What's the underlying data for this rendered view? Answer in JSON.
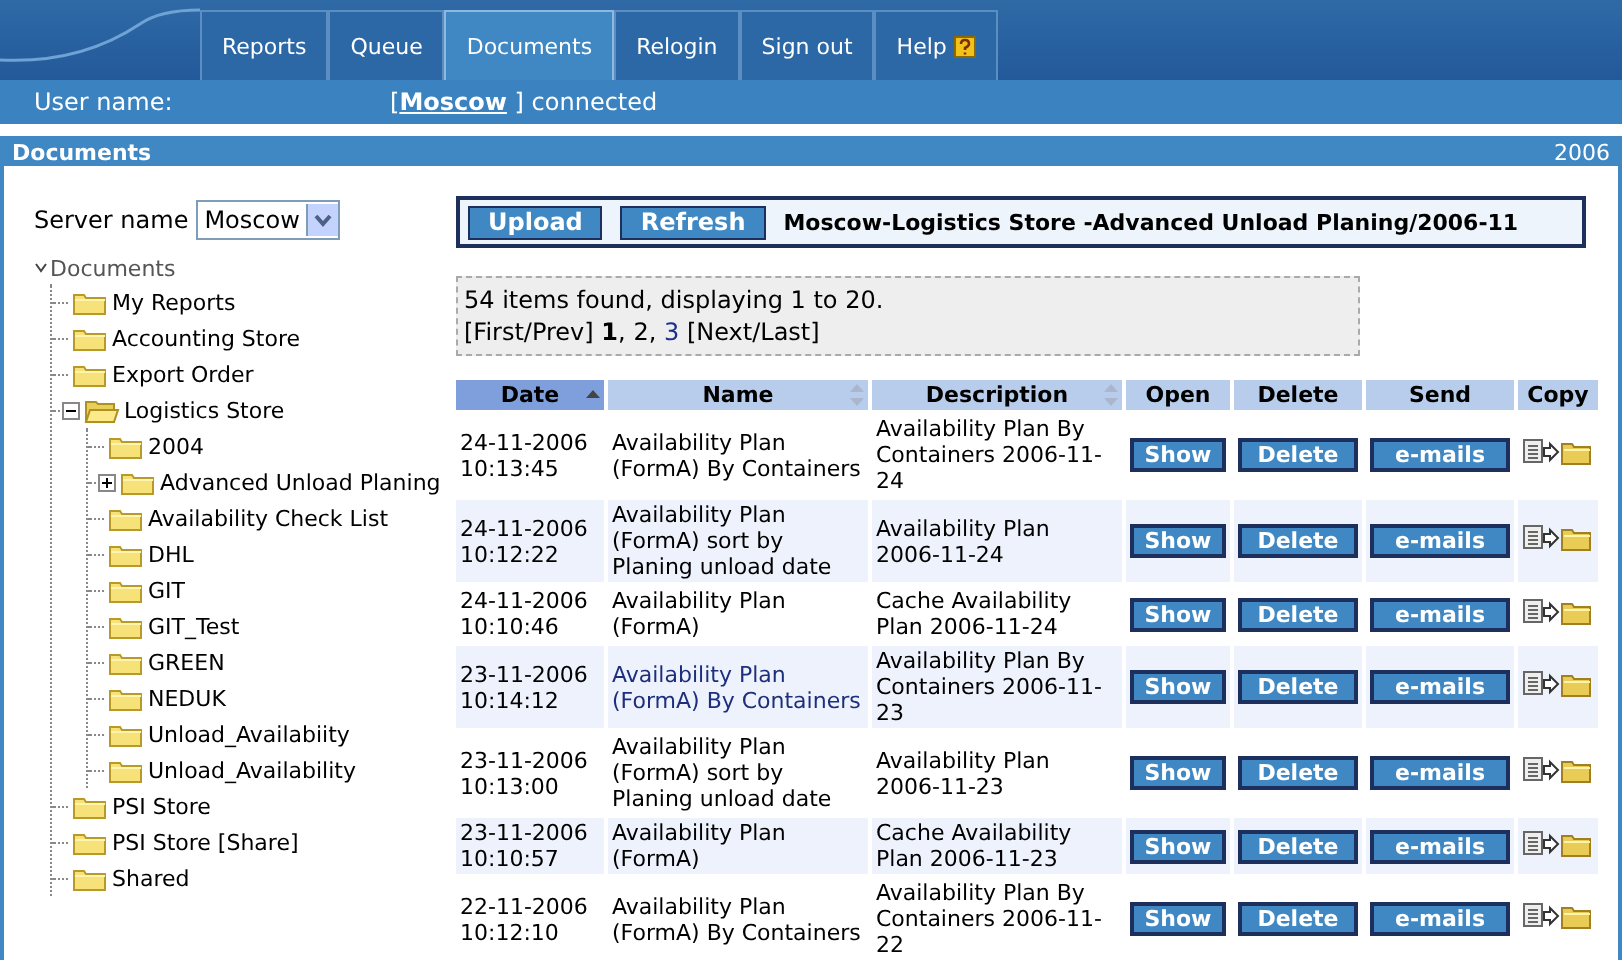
{
  "tabs": [
    {
      "label": "Reports",
      "selected": false,
      "help": false
    },
    {
      "label": "Queue",
      "selected": false,
      "help": false
    },
    {
      "label": "Documents",
      "selected": true,
      "help": false
    },
    {
      "label": "Relogin",
      "selected": false,
      "help": false
    },
    {
      "label": "Sign out",
      "selected": false,
      "help": false
    },
    {
      "label": "Help",
      "selected": false,
      "help": true
    }
  ],
  "user_bar": {
    "label": "User name:",
    "before": "[",
    "link": "Moscow",
    "after": "] connected"
  },
  "panel": {
    "title": "Documents",
    "year": "2006"
  },
  "sidebar": {
    "server_label": "Server name",
    "server_value": "Moscow",
    "tree": {
      "label": "Documents",
      "expanded": true,
      "children": [
        {
          "label": "My Reports"
        },
        {
          "label": "Accounting Store"
        },
        {
          "label": "Export Order"
        },
        {
          "label": "Logistics Store",
          "expanded": true,
          "children": [
            {
              "label": "2004"
            },
            {
              "label": "Advanced Unload Planing",
              "expanded": false
            },
            {
              "label": "Availability Check List"
            },
            {
              "label": "DHL"
            },
            {
              "label": "GIT"
            },
            {
              "label": "GIT_Test"
            },
            {
              "label": "GREEN"
            },
            {
              "label": "NEDUK"
            },
            {
              "label": "Unload_Availabiity"
            },
            {
              "label": "Unload_Availability"
            }
          ]
        },
        {
          "label": "PSI Store"
        },
        {
          "label": "PSI Store [Share]"
        },
        {
          "label": "Shared"
        }
      ]
    }
  },
  "toolbar": {
    "buttons": [
      "Upload",
      "Refresh"
    ],
    "path": "Moscow-Logistics Store -Advanced Unload Planing/2006-11"
  },
  "info": {
    "summary": "54 items found, displaying 1 to 20.",
    "before": "[First/Prev]",
    "separator": ",",
    "pages": [
      {
        "label": "1",
        "selected": true
      },
      {
        "label": "2",
        "selected": false
      },
      {
        "label": "3",
        "selected": false
      }
    ],
    "after": "[Next/Last]"
  },
  "table": {
    "columns": [
      {
        "label": "Date",
        "sortable": true,
        "selected": true
      },
      {
        "label": "Name",
        "sortable": true,
        "selected": false
      },
      {
        "label": "Description",
        "sortable": true,
        "selected": false
      },
      {
        "label": "Open",
        "sortable": false,
        "selected": false
      },
      {
        "label": "Delete",
        "sortable": false,
        "selected": false
      },
      {
        "label": "Send",
        "sortable": false,
        "selected": false
      },
      {
        "label": "Copy",
        "sortable": false,
        "selected": false
      }
    ],
    "rows": [
      {
        "date": "24-11-2006 10:13:45",
        "name": "Availability Plan (FormA) By Containers",
        "visited": false,
        "description": "Availability Plan By Containers 2006-11-24",
        "open": "Show",
        "delete": "Delete",
        "send": "e-mails"
      },
      {
        "date": "24-11-2006 10:12:22",
        "name": "Availability Plan (FormA) sort by Planing unload date",
        "visited": false,
        "description": "Availability Plan 2006-11-24",
        "open": "Show",
        "delete": "Delete",
        "send": "e-mails"
      },
      {
        "date": "24-11-2006 10:10:46",
        "name": "Availability Plan (FormA)",
        "visited": false,
        "description": "Cache Availability Plan 2006-11-24",
        "open": "Show",
        "delete": "Delete",
        "send": "e-mails"
      },
      {
        "date": "23-11-2006 10:14:12",
        "name": "Availability Plan (FormA) By Containers",
        "visited": true,
        "description": "Availability Plan By Containers 2006-11-23",
        "open": "Show",
        "delete": "Delete",
        "send": "e-mails"
      },
      {
        "date": "23-11-2006 10:13:00",
        "name": "Availability Plan (FormA) sort by Planing unload date",
        "visited": false,
        "description": "Availability Plan 2006-11-23",
        "open": "Show",
        "delete": "Delete",
        "send": "e-mails"
      },
      {
        "date": "23-11-2006 10:10:57",
        "name": "Availability Plan (FormA)",
        "visited": false,
        "description": "Cache Availability Plan 2006-11-23",
        "open": "Show",
        "delete": "Delete",
        "send": "e-mails"
      },
      {
        "date": "22-11-2006 10:12:10",
        "name": "Availability Plan (FormA) By Containers",
        "visited": false,
        "description": "Availability Plan By Containers 2006-11-22",
        "open": "Show",
        "delete": "Delete",
        "send": "e-mails"
      }
    ]
  }
}
